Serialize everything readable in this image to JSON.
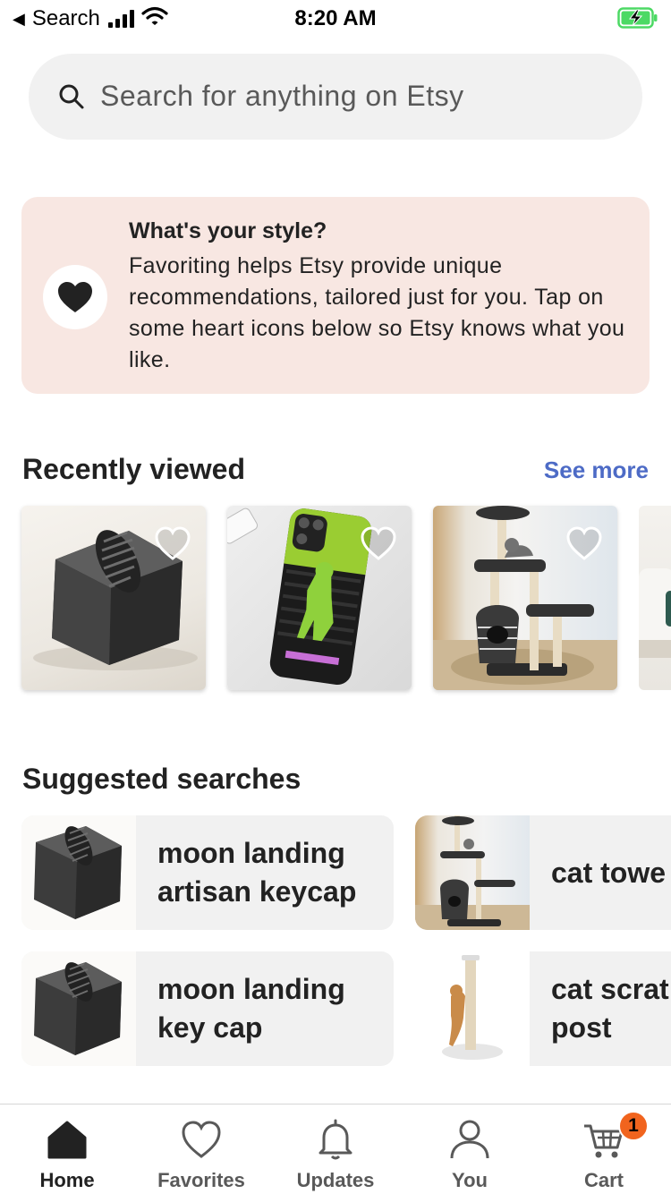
{
  "status_bar": {
    "back_label": "Search",
    "time": "8:20 AM"
  },
  "search": {
    "placeholder": "Search for anything on Etsy"
  },
  "style_banner": {
    "title": "What's your style?",
    "body": "Favoriting helps Etsy provide unique recommendations, tailored just for you. Tap on some heart icons below so Etsy knows what you like."
  },
  "recently_viewed": {
    "title": "Recently viewed",
    "see_more": "See more",
    "items": [
      {
        "icon": "moon-boot-keycap"
      },
      {
        "icon": "phone-case"
      },
      {
        "icon": "cat-tower"
      }
    ]
  },
  "suggested": {
    "title": "Suggested searches",
    "items": [
      {
        "label": "moon landing\nartisan keycap"
      },
      {
        "label": "cat towe"
      },
      {
        "label": "moon landing\nkey cap"
      },
      {
        "label": "cat scrat\npost"
      }
    ]
  },
  "nav": {
    "items": [
      {
        "label": "Home",
        "icon": "home-icon"
      },
      {
        "label": "Favorites",
        "icon": "heart-icon"
      },
      {
        "label": "Updates",
        "icon": "bell-icon"
      },
      {
        "label": "You",
        "icon": "person-icon"
      },
      {
        "label": "Cart",
        "icon": "cart-icon"
      }
    ],
    "cart_count": "1"
  },
  "colors": {
    "banner_bg": "#f8e7e2",
    "link": "#4d6bc6",
    "badge": "#f1641e"
  }
}
